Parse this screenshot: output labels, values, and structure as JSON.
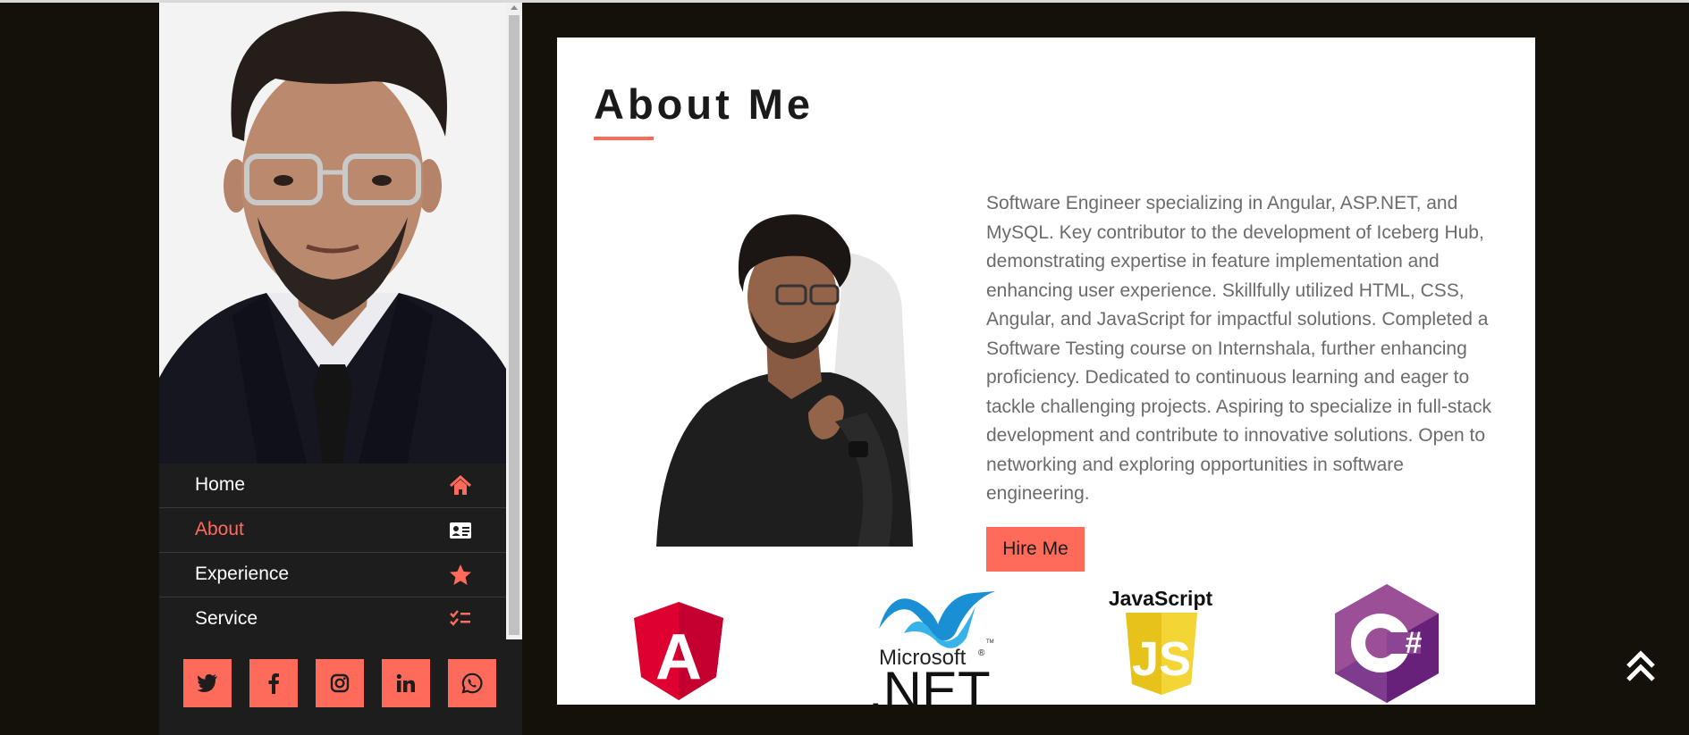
{
  "sidebar": {
    "nav": [
      {
        "label": "Home",
        "icon": "home-icon",
        "active": false
      },
      {
        "label": "About",
        "icon": "id-card-icon",
        "active": true
      },
      {
        "label": "Experience",
        "icon": "star-icon",
        "active": false
      },
      {
        "label": "Service",
        "icon": "tasks-icon",
        "active": false
      }
    ],
    "social": [
      "twitter-icon",
      "facebook-icon",
      "instagram-icon",
      "linkedin-icon",
      "whatsapp-icon"
    ]
  },
  "about": {
    "title": "About Me",
    "bio": "Software Engineer specializing in Angular, ASP.NET, and MySQL. Key contributor to the development of Iceberg Hub, demonstrating expertise in feature implementation and enhancing user experience. Skillfully utilized HTML, CSS, Angular, and JavaScript for impactful solutions. Completed a Software Testing course on Internshala, further enhancing proficiency. Dedicated to continuous learning and eager to tackle challenging projects. Aspiring to specialize in full-stack development and contribute to innovative solutions. Open to networking and exploring opportunities in software engineering.",
    "hire_label": "Hire Me"
  },
  "tech_logos": {
    "angular_letter": "A",
    "dotnet_brand": "Microsoft",
    "dotnet_mark": "®",
    "dotnet_name": ".NET",
    "dotnet_tm": "TM",
    "js_name": "JavaScript",
    "js_letters": "JS",
    "csharp_letter": "C",
    "csharp_hash": "#"
  },
  "colors": {
    "accent": "#ff6b5b",
    "page_bg": "#131109",
    "sidebar_bg": "#1d1d1d",
    "text": "#6b6b6b"
  }
}
